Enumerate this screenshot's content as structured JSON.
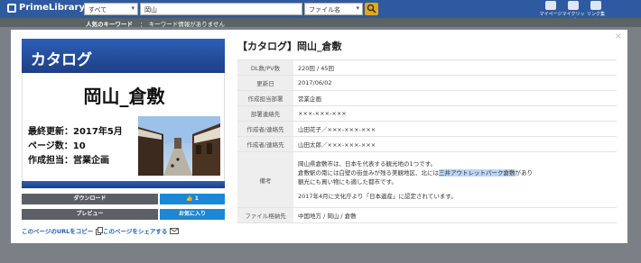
{
  "header": {
    "logo": "PrimeLibrary",
    "filter_select": "すべて",
    "search_value": "岡山",
    "field_select": "ファイル名",
    "nav_icons": [
      {
        "label": "マイページ",
        "icon": "user-icon"
      },
      {
        "label": "マイクリップ",
        "icon": "clip-icon"
      },
      {
        "label": "リンク集",
        "icon": "grid-icon"
      }
    ]
  },
  "popular": {
    "label": "人気のキーワード",
    "value": "：　キーワード情報がありません"
  },
  "card": {
    "header": "カタログ",
    "title": "岡山_倉敷",
    "meta": [
      "最終更新：2017年5月",
      "ページ数：10",
      "作成担当：営業企画"
    ]
  },
  "buttons": {
    "download": "ダウンロード",
    "like_count": "1",
    "preview": "プレビュー",
    "favorite": "お気に入り"
  },
  "links": {
    "copy_url": "このページのURLをコピー",
    "share": "このページをシェアする"
  },
  "detail": {
    "title": "【カタログ】岡山_倉敷",
    "rows": [
      {
        "label": "DL数/PV数",
        "value": "220回 / 45回"
      },
      {
        "label": "更新日",
        "value": "2017/06/02"
      },
      {
        "label": "作成担当部署",
        "value": "営業企画"
      },
      {
        "label": "部署連絡先",
        "value": "×××-×××-×××"
      },
      {
        "label": "作成者/連絡先",
        "value": "山田花子／×××-×××-×××"
      },
      {
        "label": "作成者/連絡先",
        "value": "山田太郎／×××-×××-×××"
      }
    ],
    "remarks_label": "備考",
    "remarks_line1": "岡山県倉敷市は、日本を代表する観光地の1つです。",
    "remarks_line2_pre": "倉敷駅の南には白壁の街並みが残る美観地区、北には",
    "remarks_line2_hl": "三井アウトレットパーク倉敷",
    "remarks_line2_post": "があり",
    "remarks_line3": "観光にも買い物にも適した都市です。",
    "remarks_line4": "2017年4月に文化庁より「日本遺産」に認定されています。",
    "format_label": "ファイル格納先",
    "format_value": "中国地方 / 岡山 / 倉敷"
  }
}
